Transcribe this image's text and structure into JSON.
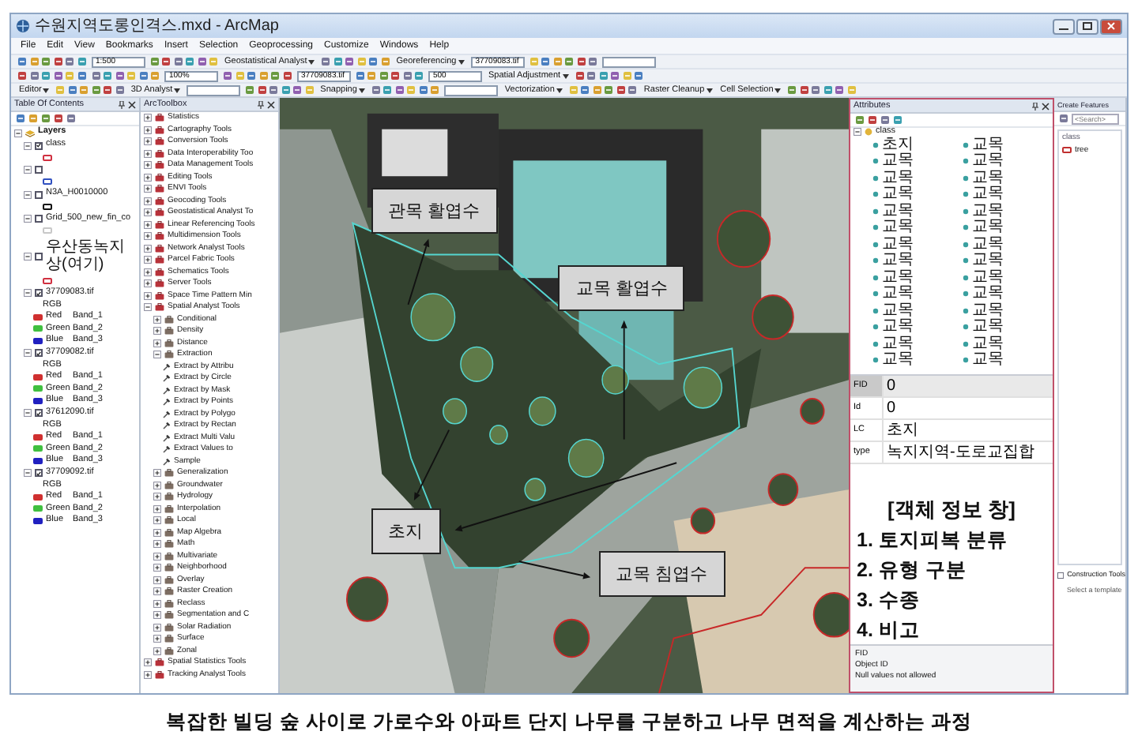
{
  "window": {
    "title": "수원지역도롱인격스.mxd - ArcMap"
  },
  "menu": [
    "File",
    "Edit",
    "View",
    "Bookmarks",
    "Insert",
    "Selection",
    "Geoprocessing",
    "Customize",
    "Windows",
    "Help"
  ],
  "toolbars": [
    [
      {
        "kind": "icons"
      },
      {
        "kind": "field",
        "value": "1:500"
      },
      {
        "kind": "icons"
      },
      {
        "kind": "menu",
        "label": "Geostatistical Analyst"
      },
      {
        "kind": "icons"
      },
      {
        "kind": "menu",
        "label": "Georeferencing"
      },
      {
        "kind": "field",
        "value": "37709083.tif"
      },
      {
        "kind": "icons"
      },
      {
        "kind": "field"
      }
    ],
    [
      {
        "kind": "icons"
      },
      {
        "kind": "icons"
      },
      {
        "kind": "field",
        "value": "100%"
      },
      {
        "kind": "icons"
      },
      {
        "kind": "field",
        "value": "37709083.tif"
      },
      {
        "kind": "icons"
      },
      {
        "kind": "field",
        "value": "500"
      },
      {
        "kind": "menu",
        "label": "Spatial Adjustment"
      },
      {
        "kind": "icons"
      }
    ],
    [
      {
        "kind": "menu",
        "label": "Editor"
      },
      {
        "kind": "icons"
      },
      {
        "kind": "menu",
        "label": "3D Analyst"
      },
      {
        "kind": "field"
      },
      {
        "kind": "icons"
      },
      {
        "kind": "menu",
        "label": "Snapping"
      },
      {
        "kind": "icons"
      },
      {
        "kind": "field"
      },
      {
        "kind": "menu",
        "label": "Vectorization"
      },
      {
        "kind": "icons"
      },
      {
        "kind": "menu",
        "label": "Raster Cleanup"
      },
      {
        "kind": "menu",
        "label": "Cell Selection"
      },
      {
        "kind": "icons"
      }
    ]
  ],
  "toc": {
    "title": "Table Of Contents",
    "root": {
      "label": "Layers",
      "expanded": true,
      "layers": [
        {
          "kind": "vector",
          "label": "class",
          "checked": true,
          "expanded": true,
          "color": "#d03040"
        },
        {
          "kind": "vector",
          "checked": false,
          "expanded": true,
          "color": "#3050c0"
        },
        {
          "kind": "vector",
          "label": "N3A_H0010000",
          "checked": false,
          "expanded": true,
          "color": "#111111"
        },
        {
          "kind": "vector",
          "label": "Grid_500_new_fin_co",
          "checked": false,
          "expanded": true,
          "color": "#c8c8c8"
        },
        {
          "kind": "vector",
          "label": "우산동녹지상(여기)",
          "checked": false,
          "expanded": true,
          "color": "#d03040"
        },
        {
          "kind": "raster",
          "label": "37709083.tif",
          "checked": true,
          "expanded": true,
          "renderer": "RGB",
          "bands": [
            {
              "label": "Red",
              "band": "Band_1",
              "color": "#d03030"
            },
            {
              "label": "Green",
              "band": "Band_2",
              "color": "#40c040"
            },
            {
              "label": "Blue",
              "band": "Band_3",
              "color": "#2020c0"
            }
          ]
        },
        {
          "kind": "raster",
          "label": "37709082.tif",
          "checked": true,
          "expanded": true,
          "renderer": "RGB",
          "bands": [
            {
              "label": "Red",
              "band": "Band_1",
              "color": "#d03030"
            },
            {
              "label": "Green",
              "band": "Band_2",
              "color": "#40c040"
            },
            {
              "label": "Blue",
              "band": "Band_3",
              "color": "#2020c0"
            }
          ]
        },
        {
          "kind": "raster",
          "label": "37612090.tif",
          "checked": true,
          "expanded": true,
          "renderer": "RGB",
          "bands": [
            {
              "label": "Red",
              "band": "Band_1",
              "color": "#d03030"
            },
            {
              "label": "Green",
              "band": "Band_2",
              "color": "#40c040"
            },
            {
              "label": "Blue",
              "band": "Band_3",
              "color": "#2020c0"
            }
          ]
        },
        {
          "kind": "raster",
          "label": "37709092.tif",
          "checked": true,
          "expanded": true,
          "renderer": "RGB",
          "bands": [
            {
              "label": "Red",
              "band": "Band_1",
              "color": "#d03030"
            },
            {
              "label": "Green",
              "band": "Band_2",
              "color": "#40c040"
            },
            {
              "label": "Blue",
              "band": "Band_3",
              "color": "#2020c0"
            }
          ]
        }
      ]
    }
  },
  "toolbox": {
    "title": "ArcToolbox",
    "items": [
      {
        "kind": "toolbox",
        "label": "Statistics",
        "expanded": false
      },
      {
        "kind": "toolbox",
        "label": "Cartography Tools",
        "expanded": false
      },
      {
        "kind": "toolbox",
        "label": "Conversion Tools",
        "expanded": false
      },
      {
        "kind": "toolbox",
        "label": "Data Interoperability Too",
        "expanded": false
      },
      {
        "kind": "toolbox",
        "label": "Data Management Tools",
        "expanded": false
      },
      {
        "kind": "toolbox",
        "label": "Editing Tools",
        "expanded": false
      },
      {
        "kind": "toolbox",
        "label": "ENVI Tools",
        "expanded": false
      },
      {
        "kind": "toolbox",
        "label": "Geocoding Tools",
        "expanded": false
      },
      {
        "kind": "toolbox",
        "label": "Geostatistical Analyst To",
        "expanded": false
      },
      {
        "kind": "toolbox",
        "label": "Linear Referencing Tools",
        "expanded": false
      },
      {
        "kind": "toolbox",
        "label": "Multidimension Tools",
        "expanded": false
      },
      {
        "kind": "toolbox",
        "label": "Network Analyst Tools",
        "expanded": false
      },
      {
        "kind": "toolbox",
        "label": "Parcel Fabric Tools",
        "expanded": false
      },
      {
        "kind": "toolbox",
        "label": "Schematics Tools",
        "expanded": false
      },
      {
        "kind": "toolbox",
        "label": "Server Tools",
        "expanded": false
      },
      {
        "kind": "toolbox",
        "label": "Space Time Pattern Min",
        "expanded": false
      },
      {
        "kind": "toolbox",
        "label": "Spatial Analyst Tools",
        "expanded": true,
        "children": [
          {
            "kind": "toolset",
            "label": "Conditional",
            "expanded": false
          },
          {
            "kind": "toolset",
            "label": "Density",
            "expanded": false
          },
          {
            "kind": "toolset",
            "label": "Distance",
            "expanded": false
          },
          {
            "kind": "toolset",
            "label": "Extraction",
            "expanded": true,
            "children": [
              {
                "kind": "tool",
                "label": "Extract by Attribu"
              },
              {
                "kind": "tool",
                "label": "Extract by Circle"
              },
              {
                "kind": "tool",
                "label": "Extract by Mask"
              },
              {
                "kind": "tool",
                "label": "Extract by Points"
              },
              {
                "kind": "tool",
                "label": "Extract by Polygo"
              },
              {
                "kind": "tool",
                "label": "Extract by Rectan"
              },
              {
                "kind": "tool",
                "label": "Extract Multi Valu"
              },
              {
                "kind": "tool",
                "label": "Extract Values to"
              },
              {
                "kind": "tool",
                "label": "Sample"
              }
            ]
          },
          {
            "kind": "toolset",
            "label": "Generalization",
            "expanded": false
          },
          {
            "kind": "toolset",
            "label": "Groundwater",
            "expanded": false
          },
          {
            "kind": "toolset",
            "label": "Hydrology",
            "expanded": false
          },
          {
            "kind": "toolset",
            "label": "Interpolation",
            "expanded": false
          },
          {
            "kind": "toolset",
            "label": "Local",
            "expanded": false
          },
          {
            "kind": "toolset",
            "label": "Map Algebra",
            "expanded": false
          },
          {
            "kind": "toolset",
            "label": "Math",
            "expanded": false
          },
          {
            "kind": "toolset",
            "label": "Multivariate",
            "expanded": false
          },
          {
            "kind": "toolset",
            "label": "Neighborhood",
            "expanded": false
          },
          {
            "kind": "toolset",
            "label": "Overlay",
            "expanded": false
          },
          {
            "kind": "toolset",
            "label": "Raster Creation",
            "expanded": false
          },
          {
            "kind": "toolset",
            "label": "Reclass",
            "expanded": false
          },
          {
            "kind": "toolset",
            "label": "Segmentation and C",
            "expanded": false
          },
          {
            "kind": "toolset",
            "label": "Solar Radiation",
            "expanded": false
          },
          {
            "kind": "toolset",
            "label": "Surface",
            "expanded": false
          },
          {
            "kind": "toolset",
            "label": "Zonal",
            "expanded": false
          }
        ]
      },
      {
        "kind": "toolbox",
        "label": "Spatial Statistics Tools",
        "expanded": false
      },
      {
        "kind": "toolbox",
        "label": "Tracking Analyst Tools",
        "expanded": false
      }
    ]
  },
  "map": {
    "labels": [
      {
        "text": "관목 활엽수"
      },
      {
        "text": "교목 활엽수"
      },
      {
        "text": "초지"
      },
      {
        "text": "교목 침엽수"
      }
    ]
  },
  "attributes": {
    "title": "Attributes",
    "root": "class",
    "expanded": true,
    "features": [
      "초지",
      "교목",
      "교목",
      "교목",
      "교목",
      "교목",
      "교목",
      "교목",
      "교목",
      "교목",
      "교목",
      "교목",
      "교목",
      "교목",
      "교목",
      "교목",
      "교목",
      "교목",
      "교목",
      "교목",
      "교목",
      "교목",
      "교목",
      "교목",
      "교목",
      "교목",
      "교목",
      "교목"
    ],
    "properties": [
      {
        "field": "FID",
        "value": "0",
        "selected": true
      },
      {
        "field": "Id",
        "value": "0",
        "selected": false
      },
      {
        "field": "LC",
        "value": "초지",
        "selected": false
      },
      {
        "field": "type",
        "value": "녹지지역-도로교집합",
        "selected": false
      }
    ],
    "note": {
      "title": "[객체 정보 창]",
      "lines": [
        "1. 토지피복 분류",
        "2. 유형 구분",
        "3. 수종",
        "4. 비고"
      ]
    },
    "info": {
      "field": "FID",
      "alias": "Object ID",
      "detail": "Null values not allowed"
    }
  },
  "create_features": {
    "title": "Create Features",
    "search": {
      "placeholder": "<Search>"
    },
    "group": "class",
    "templates": [
      {
        "label": "tree",
        "color": "#c03030"
      }
    ],
    "construction": {
      "title": "Construction Tools",
      "hint": "Select a template"
    }
  },
  "caption": "복잡한 빌딩 숲 사이로 가로수와 아파트 단지 나무를 구분하고 나무 면적을 계산하는 과정"
}
